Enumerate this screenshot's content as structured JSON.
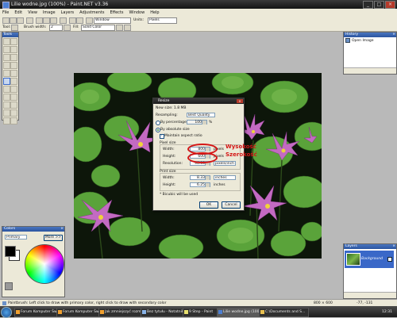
{
  "window": {
    "title": "Lilie wodne.jpg (100%) - Paint.NET v3.36",
    "controls": [
      "_",
      "□",
      "×"
    ]
  },
  "menu": [
    "File",
    "Edit",
    "View",
    "Image",
    "Layers",
    "Adjustments",
    "Effects",
    "Window",
    "Help"
  ],
  "toolbar": {
    "zoom_mode": "Window",
    "units_label": "Units:",
    "units_value": "Pixels",
    "tool_label": "Tool:",
    "brush_width_label": "Brush width:",
    "brush_width_value": "2",
    "fill_label": "Fill:",
    "fill_value": "Solid Color"
  },
  "tools_panel": {
    "title": "Tools"
  },
  "history_panel": {
    "title": "History",
    "items": [
      "Open Image"
    ]
  },
  "colors_panel": {
    "title": "Colors",
    "mode": "Primary",
    "more_button": "More >>",
    "primary_color": "#000000",
    "secondary_color": "#ffffff"
  },
  "layers_panel": {
    "title": "Layers",
    "layer_name": "Background"
  },
  "resize_dialog": {
    "title": "Resize",
    "new_size": "New size: 1.8 MB",
    "resampling_label": "Resampling:",
    "resampling_value": "Best Quality",
    "by_percentage_label": "By percentage:",
    "percentage_value": "100",
    "percent_sign": "%",
    "by_absolute_label": "By absolute size",
    "maintain_aspect_label": "Maintain aspect ratio",
    "pixel_size_label": "Pixel size",
    "width_label": "Width:",
    "width_value": "800",
    "width_unit": "pixels",
    "height_label": "Height:",
    "height_value": "600",
    "height_unit": "pixels",
    "resolution_label": "Resolution:",
    "resolution_value": "96.00",
    "resolution_unit": "pixels/inch",
    "print_size_label": "Print size",
    "print_width_value": "8.33",
    "print_width_unit": "inches",
    "print_height_value": "6.25",
    "print_height_unit": "inches",
    "bicubic_note": "* Bicubic will be used",
    "ok_button": "OK",
    "cancel_button": "Cancel"
  },
  "annotations": {
    "wysokosc": "Wysokość",
    "szerokosc": "Szerokość",
    "color": "#d41616"
  },
  "status": {
    "hint": "Paintbrush: Left click to draw with primary color, right click to draw with secondary color",
    "image_size": "800 × 600",
    "cursor_pos": "-77, -131"
  },
  "taskbar": {
    "items": [
      "Forum Komputer Św...",
      "Forum Komputer Św...",
      "Jak zmniejszyć rozm...",
      "Bez tytułu - Notatnik",
      "9 Step - Paint",
      "Lilie wodne.jpg (100...",
      "C:\\Documents and S..."
    ],
    "clock": "12:31"
  }
}
